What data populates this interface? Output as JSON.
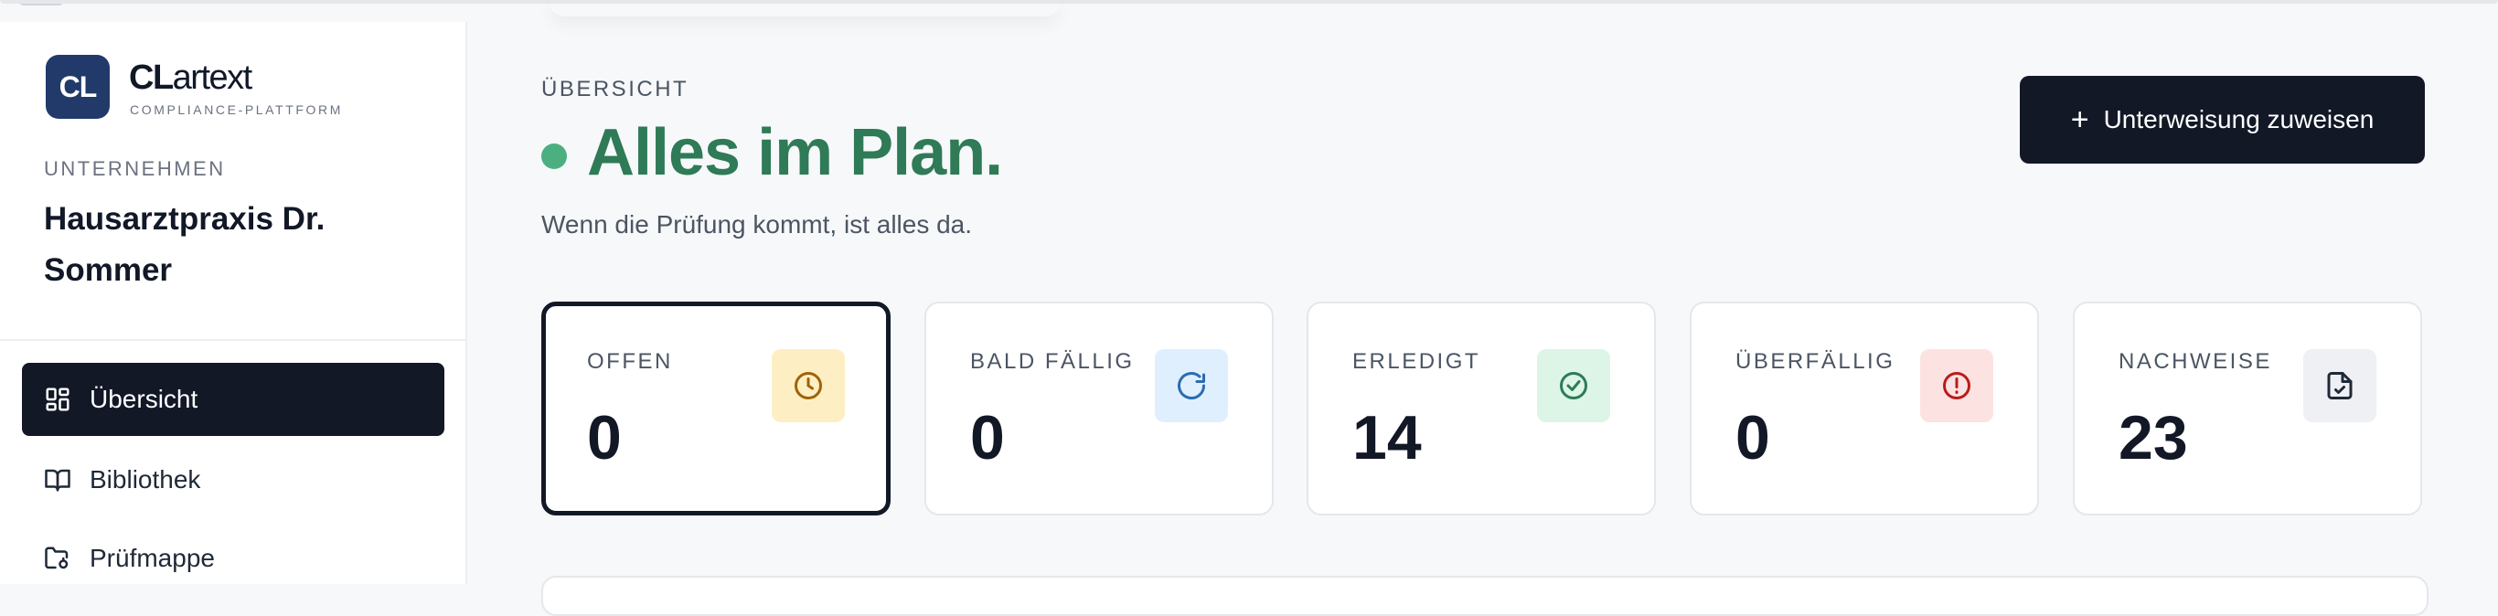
{
  "brand": {
    "logo_text": "CL",
    "name_bold": "CL",
    "name_rest": "artext",
    "tagline": "COMPLIANCE-PLATTFORM"
  },
  "company": {
    "label": "UNTERNEHMEN",
    "name": "Hausarztpraxis Dr. Sommer"
  },
  "nav": {
    "items": [
      {
        "label": "Übersicht",
        "icon": "dashboard-icon",
        "active": true
      },
      {
        "label": "Bibliothek",
        "icon": "book-icon",
        "active": false
      },
      {
        "label": "Prüfmappe",
        "icon": "folder-icon",
        "active": false
      }
    ]
  },
  "header": {
    "eyebrow": "ÜBERSICHT",
    "title": "Alles im Plan.",
    "subtitle": "Wenn die Prüfung kommt, ist alles da.",
    "status_color": "#4caf80",
    "title_color": "#2f7a57"
  },
  "cta": {
    "icon": "plus-icon",
    "label": "Unterweisung zuweisen"
  },
  "stats": [
    {
      "label": "OFFEN",
      "value": "0",
      "icon": "clock-icon",
      "icon_bg": "#fdefc3",
      "icon_color": "#a16207",
      "selected": true
    },
    {
      "label": "BALD FÄLLIG",
      "value": "0",
      "icon": "refresh-icon",
      "icon_bg": "#e0effd",
      "icon_color": "#2b6cb0",
      "selected": false
    },
    {
      "label": "ERLEDIGT",
      "value": "14",
      "icon": "check-circle-icon",
      "icon_bg": "#dcf5e7",
      "icon_color": "#2f7a57",
      "selected": false
    },
    {
      "label": "ÜBERFÄLLIG",
      "value": "0",
      "icon": "alert-circle-icon",
      "icon_bg": "#fde2e2",
      "icon_color": "#b91c1c",
      "selected": false
    },
    {
      "label": "NACHWEISE",
      "value": "23",
      "icon": "file-check-icon",
      "icon_bg": "#eef0f4",
      "icon_color": "#1f2937",
      "selected": false
    }
  ]
}
